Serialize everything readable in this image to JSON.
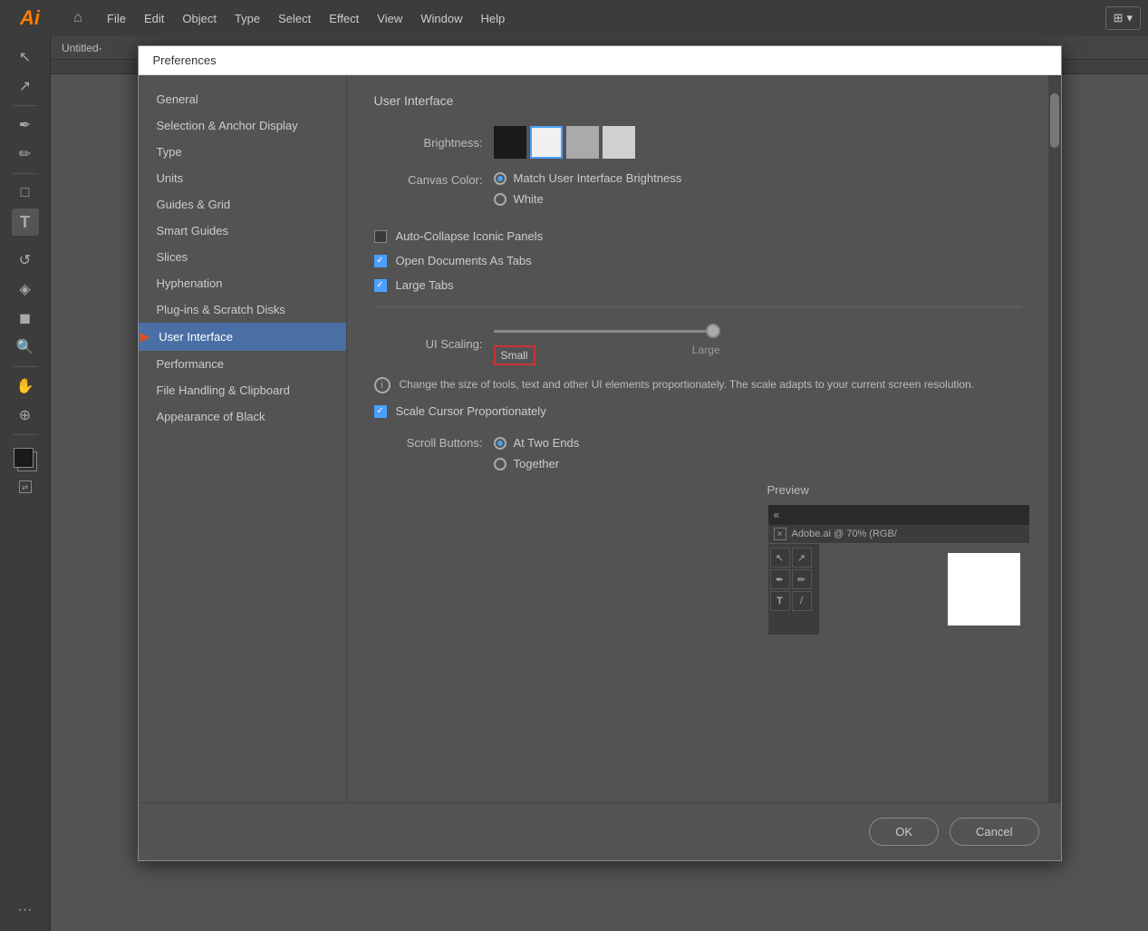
{
  "app": {
    "logo": "Ai",
    "title": "Untitled-"
  },
  "menubar": {
    "items": [
      "File",
      "Edit",
      "Object",
      "Type",
      "Select",
      "Effect",
      "View",
      "Window",
      "Help"
    ]
  },
  "dialog": {
    "title": "Preferences",
    "nav": [
      {
        "id": "general",
        "label": "General",
        "active": false
      },
      {
        "id": "selection",
        "label": "Selection & Anchor Display",
        "active": false
      },
      {
        "id": "type",
        "label": "Type",
        "active": false
      },
      {
        "id": "units",
        "label": "Units",
        "active": false
      },
      {
        "id": "guides",
        "label": "Guides & Grid",
        "active": false
      },
      {
        "id": "smart-guides",
        "label": "Smart Guides",
        "active": false
      },
      {
        "id": "slices",
        "label": "Slices",
        "active": false
      },
      {
        "id": "hyphenation",
        "label": "Hyphenation",
        "active": false
      },
      {
        "id": "plugins",
        "label": "Plug-ins & Scratch Disks",
        "active": false
      },
      {
        "id": "user-interface",
        "label": "User Interface",
        "active": true
      },
      {
        "id": "performance",
        "label": "Performance",
        "active": false
      },
      {
        "id": "file-handling",
        "label": "File Handling & Clipboard",
        "active": false
      },
      {
        "id": "appearance",
        "label": "Appearance of Black",
        "active": false
      }
    ],
    "content": {
      "section_title": "User Interface",
      "brightness_label": "Brightness:",
      "canvas_color_label": "Canvas Color:",
      "canvas_color_options": [
        {
          "id": "match",
          "label": "Match User Interface Brightness",
          "checked": true
        },
        {
          "id": "white",
          "label": "White",
          "checked": false
        }
      ],
      "checkboxes": [
        {
          "id": "auto-collapse",
          "label": "Auto-Collapse Iconic Panels",
          "checked": false
        },
        {
          "id": "open-as-tabs",
          "label": "Open Documents As Tabs",
          "checked": true
        },
        {
          "id": "large-tabs",
          "label": "Large Tabs",
          "checked": true
        }
      ],
      "ui_scaling_label": "UI Scaling:",
      "slider_small": "Small",
      "slider_large": "Large",
      "scale_info": "Change the size of tools, text and other UI elements proportionately. The scale adapts to your current screen resolution.",
      "scale_cursor_checkbox": {
        "id": "scale-cursor",
        "label": "Scale Cursor Proportionately",
        "checked": true
      },
      "preview_title": "Preview",
      "preview_tab": "Adobe.ai @ 70% (RGB/",
      "scroll_buttons_label": "Scroll Buttons:",
      "scroll_options": [
        {
          "id": "at-two-ends",
          "label": "At Two Ends",
          "checked": true
        },
        {
          "id": "together",
          "label": "Together",
          "checked": false
        }
      ]
    },
    "footer": {
      "ok": "OK",
      "cancel": "Cancel"
    }
  }
}
